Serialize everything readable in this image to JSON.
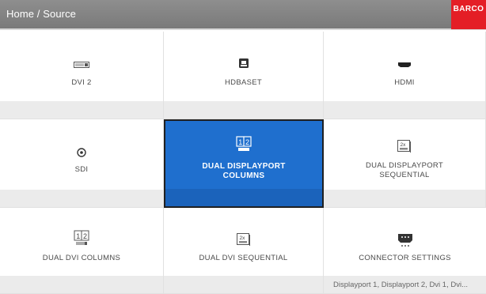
{
  "header": {
    "breadcrumb": "Home / Source",
    "logo": "BARCO"
  },
  "colors": {
    "selected": "#1f6fce",
    "brand": "#e41e26"
  },
  "tiles": [
    {
      "label": "DVI 2",
      "icon": "dvi-connector-icon",
      "footer": ""
    },
    {
      "label": "HDBASET",
      "icon": "hdbaset-connector-icon",
      "footer": ""
    },
    {
      "label": "HDMI",
      "icon": "hdmi-connector-icon",
      "footer": ""
    },
    {
      "label": "SDI",
      "icon": "sdi-connector-icon",
      "footer": ""
    },
    {
      "label": "DUAL DISPLAYPORT\nCOLUMNS",
      "icon": "dual-columns-icon",
      "footer": "",
      "selected": true
    },
    {
      "label": "DUAL DISPLAYPORT\nSEQUENTIAL",
      "icon": "dual-sequential-icon",
      "footer": ""
    },
    {
      "label": "DUAL DVI COLUMNS",
      "icon": "dual-dvi-columns-icon",
      "footer": ""
    },
    {
      "label": "DUAL DVI SEQUENTIAL",
      "icon": "dual-dvi-sequential-icon",
      "footer": ""
    },
    {
      "label": "CONNECTOR SETTINGS",
      "icon": "connector-settings-icon",
      "footer": "Displayport 1, Displayport 2, Dvi 1, Dvi..."
    }
  ]
}
